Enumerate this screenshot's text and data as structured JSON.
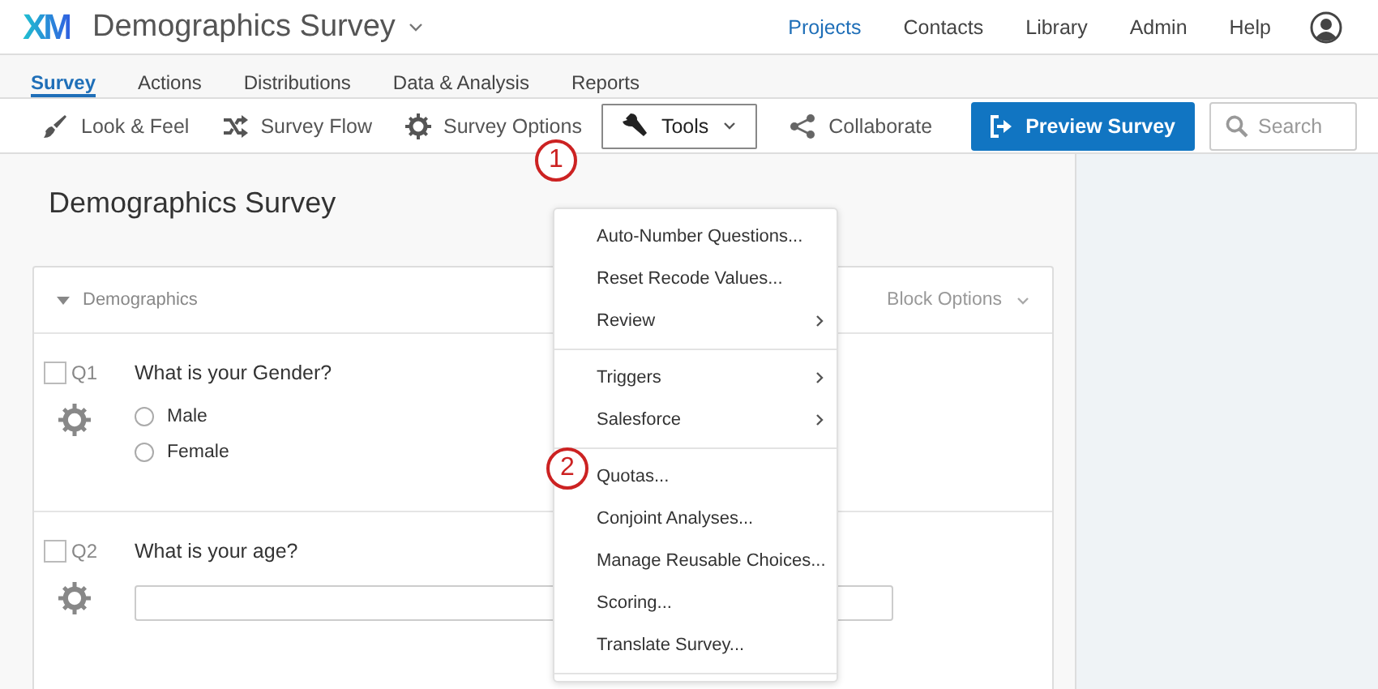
{
  "header": {
    "logo": "XM",
    "title": "Demographics Survey",
    "nav": [
      {
        "label": "Projects",
        "selected": true
      },
      {
        "label": "Contacts",
        "selected": false
      },
      {
        "label": "Library",
        "selected": false
      },
      {
        "label": "Admin",
        "selected": false
      },
      {
        "label": "Help",
        "selected": false
      }
    ]
  },
  "tabs": [
    {
      "label": "Survey",
      "selected": true
    },
    {
      "label": "Actions",
      "selected": false
    },
    {
      "label": "Distributions",
      "selected": false
    },
    {
      "label": "Data & Analysis",
      "selected": false
    },
    {
      "label": "Reports",
      "selected": false
    }
  ],
  "toolbar": {
    "items": [
      {
        "kind": "brush",
        "label": "Look & Feel"
      },
      {
        "kind": "flow",
        "label": "Survey Flow"
      },
      {
        "kind": "gear",
        "label": "Survey Options"
      },
      {
        "kind": "wrench",
        "label": "Tools",
        "expanded": true
      },
      {
        "kind": "share",
        "label": "Collaborate"
      }
    ],
    "preview_button": "Preview Survey",
    "search": {
      "placeholder": "Search"
    }
  },
  "tools_menu": [
    [
      {
        "label": "Auto-Number Questions...",
        "submenu": false
      },
      {
        "label": "Reset Recode Values...",
        "submenu": false
      },
      {
        "label": "Review",
        "submenu": true
      }
    ],
    [
      {
        "label": "Triggers",
        "submenu": true
      },
      {
        "label": "Salesforce",
        "submenu": true
      }
    ],
    [
      {
        "label": "Quotas...",
        "submenu": false
      },
      {
        "label": "Conjoint Analyses...",
        "submenu": false
      },
      {
        "label": "Manage Reusable Choices...",
        "submenu": false
      },
      {
        "label": "Scoring...",
        "submenu": false
      },
      {
        "label": "Translate Survey...",
        "submenu": false
      }
    ]
  ],
  "annotations": [
    {
      "label": "1"
    },
    {
      "label": "2"
    }
  ],
  "survey": {
    "title": "Demographics Survey",
    "block": {
      "name": "Demographics",
      "options": "Block Options",
      "questions": [
        {
          "kind": "choice",
          "number": "Q1",
          "checked": false,
          "text": "What is your Gender?",
          "choices": [
            {
              "label": "Male",
              "selected": false
            },
            {
              "label": "Female",
              "selected": false
            }
          ]
        },
        {
          "kind": "text",
          "number": "Q2",
          "checked": false,
          "text": "What is your age?"
        }
      ]
    }
  }
}
